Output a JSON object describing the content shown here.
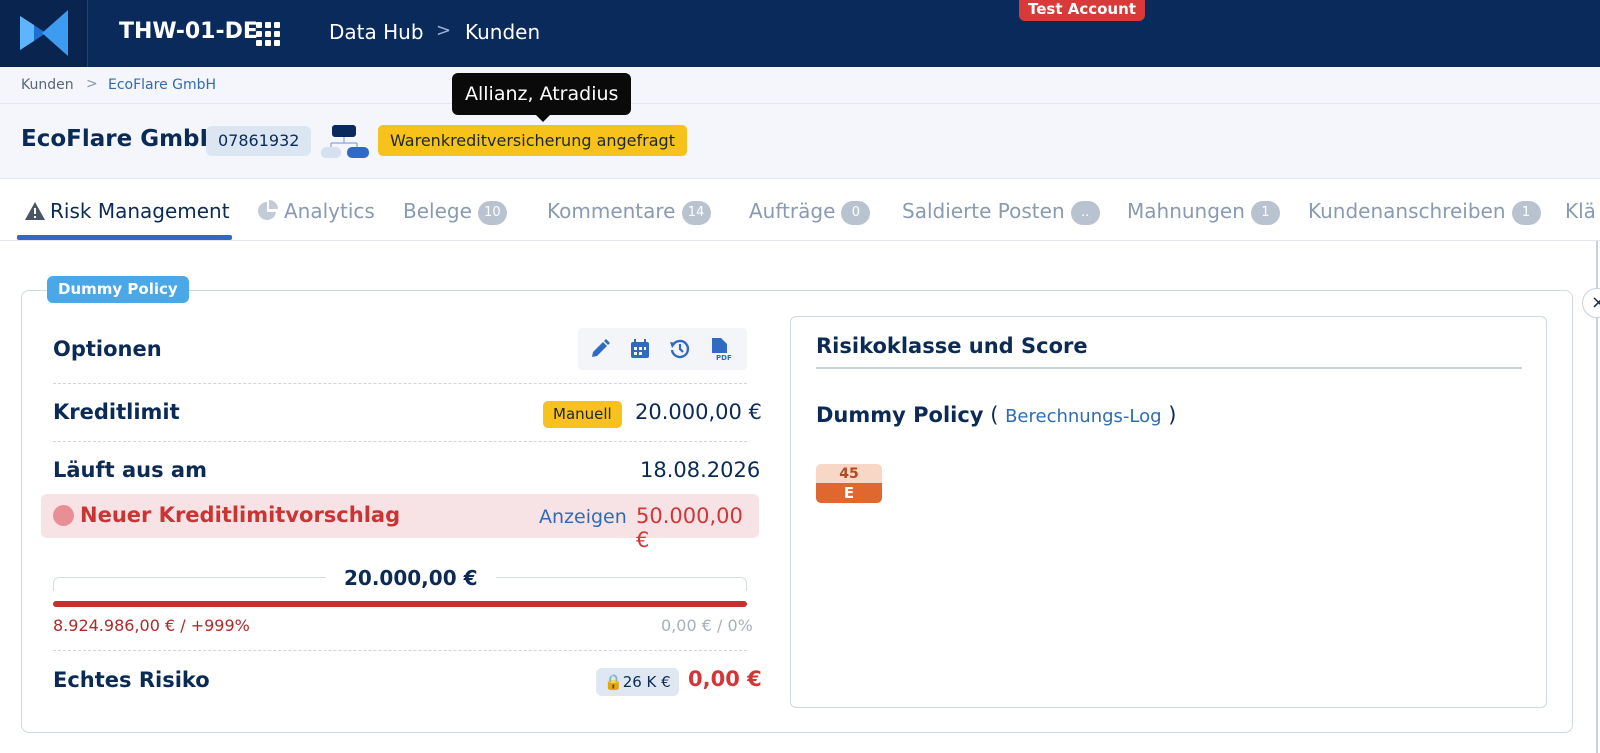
{
  "topbar": {
    "tenant": "THW-01-DE",
    "nav": [
      "Data Hub",
      "Kunden"
    ],
    "nav_separator": ">",
    "test_badge": "Test Account"
  },
  "breadcrumb": {
    "items": [
      "Kunden",
      "EcoFlare GmbH"
    ],
    "separator": ">"
  },
  "customer": {
    "name": "EcoFlare GmbH",
    "id": "07861932",
    "status_badge": "Warenkreditversicherung angefragt",
    "tooltip": "Allianz, Atradius"
  },
  "tabs": [
    {
      "label": "Risk Management",
      "count": null,
      "active": true
    },
    {
      "label": "Analytics",
      "count": null
    },
    {
      "label": "Belege",
      "count": "10"
    },
    {
      "label": "Kommentare",
      "count": "14"
    },
    {
      "label": "Aufträge",
      "count": "0"
    },
    {
      "label": "Saldierte Posten",
      "count": ".."
    },
    {
      "label": "Mahnungen",
      "count": "1"
    },
    {
      "label": "Kundenanschreiben",
      "count": "1"
    },
    {
      "label": "Klä",
      "count": null
    }
  ],
  "policy": {
    "tag": "Dummy Policy",
    "options_title": "Optionen",
    "tools": [
      "pencil-icon",
      "calendar-icon",
      "history-icon",
      "pdf-icon"
    ],
    "credit_limit_label": "Kreditlimit",
    "credit_limit_badge": "Manuell",
    "credit_limit_value": "20.000,00 €",
    "expires_label": "Läuft aus am",
    "expires_value": "18.08.2026",
    "proposal_label": "Neuer Kreditlimitvorschlag",
    "proposal_link": "Anzeigen",
    "proposal_value": "50.000,00 €",
    "usage_amount": "20.000,00 €",
    "usage_fill_fraction": 1.0,
    "usage_left": "8.924.986,00 € / +999%",
    "usage_right": "0,00 € / 0%",
    "real_risk_label": "Echtes Risiko",
    "real_risk_badge": "26 K €",
    "real_risk_value": "0,00 €"
  },
  "risk_card": {
    "title": "Risikoklasse und Score",
    "policy_name": "Dummy Policy",
    "paren_open": "(",
    "log_link": "Berechnungs-Log",
    "paren_close": ")",
    "score": "45",
    "grade": "E"
  },
  "colors": {
    "topbar": "#0b2a5c",
    "accent": "#2f6bc4",
    "warning": "#f6c21b",
    "danger": "#d23636",
    "grade_e": "#e0672d"
  }
}
